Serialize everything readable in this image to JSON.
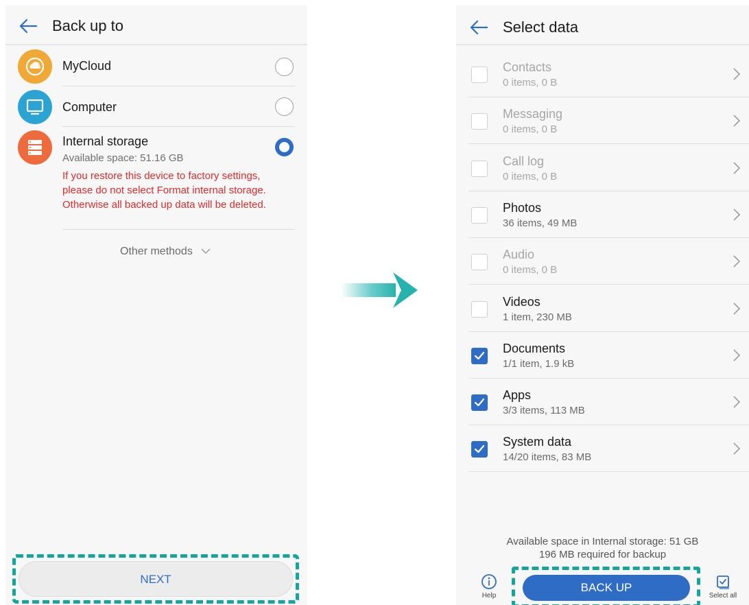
{
  "left_screen": {
    "title": "Back up to",
    "methods": [
      {
        "label": "MyCloud",
        "icon": "cloud-icon",
        "color": "#f0a837",
        "selected": false
      },
      {
        "label": "Computer",
        "icon": "monitor-icon",
        "color": "#2ba3d3",
        "selected": false
      },
      {
        "label": "Internal storage",
        "icon": "storage-icon",
        "color": "#ee6b3d",
        "selected": true,
        "sub": "Available space: 51.16 GB",
        "warning": "If you restore this device to factory settings, please do not select Format internal storage. Otherwise all backed up data will be deleted."
      }
    ],
    "other_methods": "Other methods",
    "next_label": "NEXT"
  },
  "right_screen": {
    "title": "Select data",
    "items": [
      {
        "name": "Contacts",
        "detail": "0 items, 0 B",
        "checked": false,
        "enabled": false
      },
      {
        "name": "Messaging",
        "detail": "0 items, 0 B",
        "checked": false,
        "enabled": false
      },
      {
        "name": "Call log",
        "detail": "0 items, 0 B",
        "checked": false,
        "enabled": false
      },
      {
        "name": "Photos",
        "detail": "36 items, 49 MB",
        "checked": false,
        "enabled": true
      },
      {
        "name": "Audio",
        "detail": "0 items, 0 B",
        "checked": false,
        "enabled": false
      },
      {
        "name": "Videos",
        "detail": "1 item, 230 MB",
        "checked": false,
        "enabled": true
      },
      {
        "name": "Documents",
        "detail": "1/1 item, 1.9 kB",
        "checked": true,
        "enabled": true
      },
      {
        "name": "Apps",
        "detail": "3/3 items, 113 MB",
        "checked": true,
        "enabled": true
      },
      {
        "name": "System data",
        "detail": "14/20 items, 83 MB",
        "checked": true,
        "enabled": true
      }
    ],
    "available_space": "Available space in Internal storage: 51 GB",
    "required_space": "196 MB required for backup",
    "backup_label": "BACK UP",
    "help_label": "Help",
    "select_all_label": "Select all"
  },
  "colors": {
    "accent": "#2f6cc6",
    "warning": "#e02b2b",
    "highlight": "#15a59b"
  }
}
